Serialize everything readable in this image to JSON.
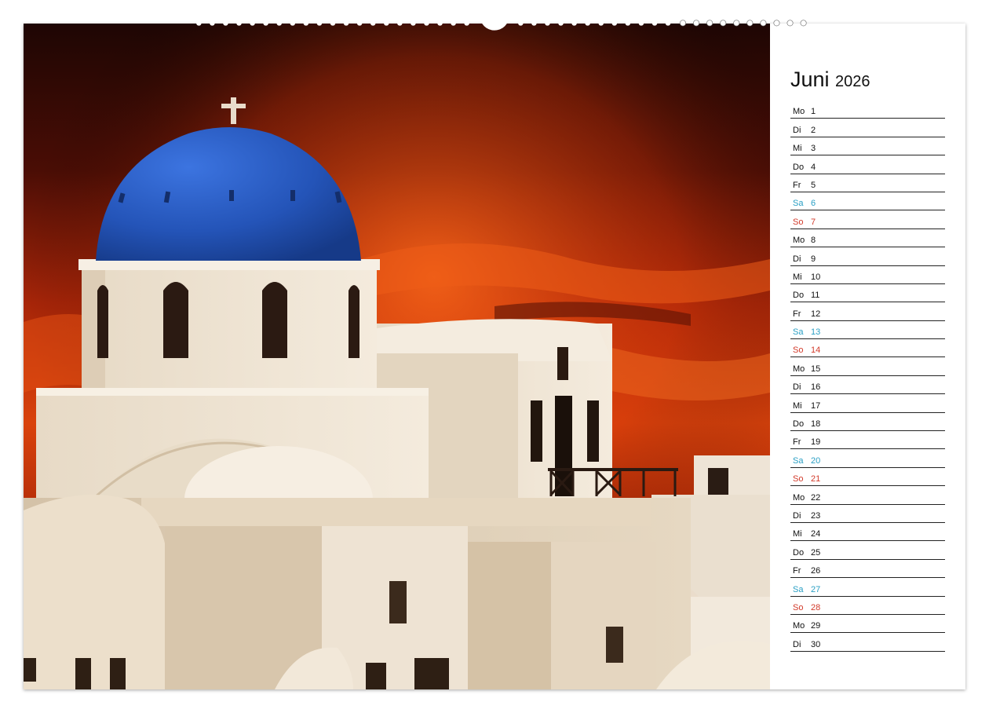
{
  "calendar": {
    "month": "Juni",
    "year": "2026",
    "days": [
      {
        "wd": "Mo",
        "d": "1",
        "type": "weekday"
      },
      {
        "wd": "Di",
        "d": "2",
        "type": "weekday"
      },
      {
        "wd": "Mi",
        "d": "3",
        "type": "weekday"
      },
      {
        "wd": "Do",
        "d": "4",
        "type": "weekday"
      },
      {
        "wd": "Fr",
        "d": "5",
        "type": "weekday"
      },
      {
        "wd": "Sa",
        "d": "6",
        "type": "sat"
      },
      {
        "wd": "So",
        "d": "7",
        "type": "sun"
      },
      {
        "wd": "Mo",
        "d": "8",
        "type": "weekday"
      },
      {
        "wd": "Di",
        "d": "9",
        "type": "weekday"
      },
      {
        "wd": "Mi",
        "d": "10",
        "type": "weekday"
      },
      {
        "wd": "Do",
        "d": "11",
        "type": "weekday"
      },
      {
        "wd": "Fr",
        "d": "12",
        "type": "weekday"
      },
      {
        "wd": "Sa",
        "d": "13",
        "type": "sat"
      },
      {
        "wd": "So",
        "d": "14",
        "type": "sun"
      },
      {
        "wd": "Mo",
        "d": "15",
        "type": "weekday"
      },
      {
        "wd": "Di",
        "d": "16",
        "type": "weekday"
      },
      {
        "wd": "Mi",
        "d": "17",
        "type": "weekday"
      },
      {
        "wd": "Do",
        "d": "18",
        "type": "weekday"
      },
      {
        "wd": "Fr",
        "d": "19",
        "type": "weekday"
      },
      {
        "wd": "Sa",
        "d": "20",
        "type": "sat"
      },
      {
        "wd": "So",
        "d": "21",
        "type": "sun"
      },
      {
        "wd": "Mo",
        "d": "22",
        "type": "weekday"
      },
      {
        "wd": "Di",
        "d": "23",
        "type": "weekday"
      },
      {
        "wd": "Mi",
        "d": "24",
        "type": "weekday"
      },
      {
        "wd": "Do",
        "d": "25",
        "type": "weekday"
      },
      {
        "wd": "Fr",
        "d": "26",
        "type": "weekday"
      },
      {
        "wd": "Sa",
        "d": "27",
        "type": "sat"
      },
      {
        "wd": "So",
        "d": "28",
        "type": "sun"
      },
      {
        "wd": "Mo",
        "d": "29",
        "type": "weekday"
      },
      {
        "wd": "Di",
        "d": "30",
        "type": "weekday"
      }
    ]
  },
  "colors": {
    "saturday": "#2a9fc4",
    "sunday": "#d23a2a",
    "dome": "#2f5fc8",
    "sky": "#c8320a",
    "walls": "#efe4d4"
  },
  "photo": {
    "subject_icon": "church-dome-icon"
  }
}
